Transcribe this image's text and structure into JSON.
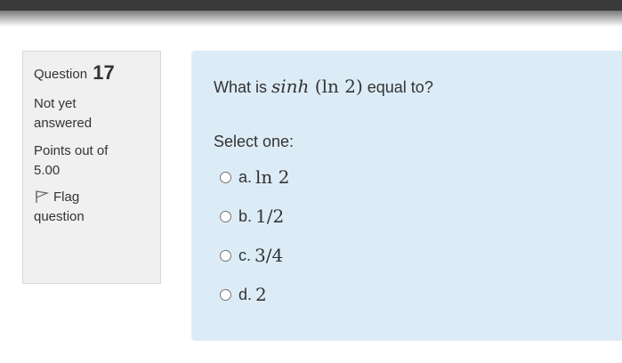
{
  "info": {
    "question_label": "Question",
    "question_number": "17",
    "state_line1": "Not yet",
    "state_line2": "answered",
    "grade_line1": "Points out of",
    "grade_line2": "5.00",
    "flag_line1": "Flag",
    "flag_line2": "question"
  },
  "question": {
    "prefix": "What is ",
    "fn": "sinh",
    "arg": "(ln 2)",
    "suffix": " equal to?",
    "prompt": "Select one:"
  },
  "answers": [
    {
      "letter": "a.",
      "value": "ln 2"
    },
    {
      "letter": "b.",
      "value": "1/2"
    },
    {
      "letter": "c.",
      "value": "3/4"
    },
    {
      "letter": "d.",
      "value": "2"
    }
  ]
}
